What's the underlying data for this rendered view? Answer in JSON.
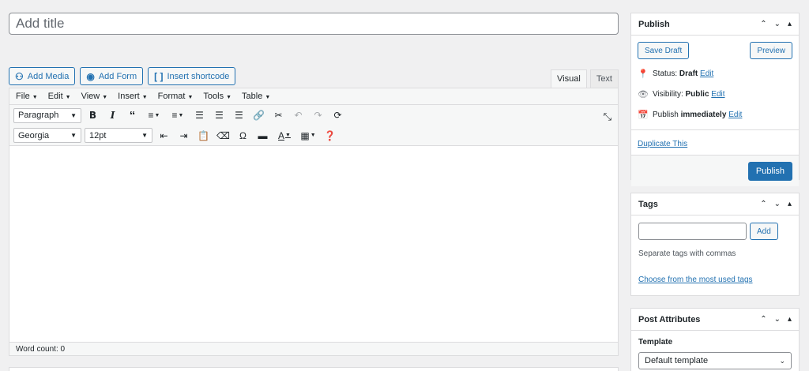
{
  "title": {
    "placeholder": "Add title"
  },
  "media_buttons": [
    {
      "label": "Add Media"
    },
    {
      "label": "Add Form"
    },
    {
      "label": "Insert shortcode"
    }
  ],
  "editor_tabs": {
    "visual": "Visual",
    "text": "Text",
    "active": "Visual"
  },
  "menubar": [
    "File",
    "Edit",
    "View",
    "Insert",
    "Format",
    "Tools",
    "Table"
  ],
  "toolbar": {
    "format_select": "Paragraph",
    "font_select": "Georgia",
    "size_select": "12pt",
    "icons_row1": [
      "bold-icon",
      "italic-icon",
      "blockquote-icon",
      "bullet-list-icon",
      "numbered-list-icon",
      "align-left-icon",
      "align-center-icon",
      "align-right-icon",
      "link-icon",
      "unlink-icon",
      "undo-icon",
      "redo-icon",
      "refresh-icon",
      "fullscreen-icon"
    ],
    "icons_row2": [
      "outdent-icon",
      "indent-icon",
      "paste-text-icon",
      "clear-formatting-icon",
      "omega-icon",
      "read-more-icon",
      "text-color-icon",
      "table-icon",
      "help-icon"
    ]
  },
  "editor": {
    "word_count": "Word count: 0"
  },
  "publish": {
    "title": "Publish",
    "save_draft": "Save Draft",
    "preview": "Preview",
    "status_label": "Status:",
    "status_value": "Draft",
    "visibility_label": "Visibility:",
    "visibility_value": "Public",
    "publish_label": "Publish",
    "publish_value": "immediately",
    "edit": "Edit",
    "duplicate": "Duplicate This",
    "publish_button": "Publish"
  },
  "tags": {
    "title": "Tags",
    "add": "Add",
    "hint": "Separate tags with commas",
    "choose": "Choose from the most used tags"
  },
  "post_attributes": {
    "title": "Post Attributes",
    "template_label": "Template",
    "template_value": "Default template"
  },
  "colors": {
    "accent": "#2271b1",
    "background": "#f0f0f1",
    "border": "#dcdcde"
  }
}
